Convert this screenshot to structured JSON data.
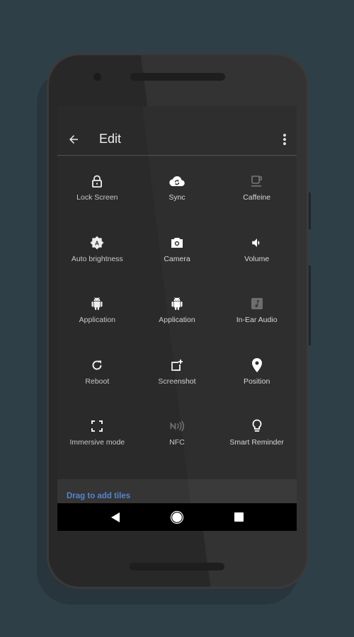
{
  "colors": {
    "background": "#2f3f48",
    "phone_body": "#333333",
    "screen": "#2e2e2e",
    "accent": "#5b8fe0",
    "icon_active": "#ffffff",
    "icon_disabled": "#777777"
  },
  "appbar": {
    "back_icon": "arrow-back-icon",
    "title": "Edit",
    "menu_icon": "more-vert-icon"
  },
  "tiles": [
    {
      "label": "Lock Screen",
      "icon": "lock-icon",
      "enabled": true
    },
    {
      "label": "Sync",
      "icon": "cloud-sync-icon",
      "enabled": true
    },
    {
      "label": "Caffeine",
      "icon": "coffee-cup-icon",
      "enabled": false
    },
    {
      "label": "Auto brightness",
      "icon": "brightness-auto-icon",
      "enabled": true
    },
    {
      "label": "Camera",
      "icon": "camera-icon",
      "enabled": true
    },
    {
      "label": "Volume",
      "icon": "volume-icon",
      "enabled": true
    },
    {
      "label": "Application",
      "icon": "android-icon",
      "enabled": true
    },
    {
      "label": "Application",
      "icon": "android-icon",
      "enabled": true
    },
    {
      "label": "In-Ear Audio",
      "icon": "music-note-icon",
      "enabled": false
    },
    {
      "label": "Reboot",
      "icon": "reboot-icon",
      "enabled": true
    },
    {
      "label": "Screenshot",
      "icon": "screenshot-add-icon",
      "enabled": true
    },
    {
      "label": "Position",
      "icon": "location-pin-icon",
      "enabled": true
    },
    {
      "label": "Immersive mode",
      "icon": "fullscreen-icon",
      "enabled": true
    },
    {
      "label": "NFC",
      "icon": "nfc-icon",
      "enabled": false
    },
    {
      "label": "Smart Reminder",
      "icon": "lightbulb-icon",
      "enabled": true
    }
  ],
  "add_section": {
    "label": "Drag to add tiles"
  },
  "navbar": {
    "back": "nav-back-icon",
    "home": "nav-home-icon",
    "recents": "nav-recents-icon"
  }
}
